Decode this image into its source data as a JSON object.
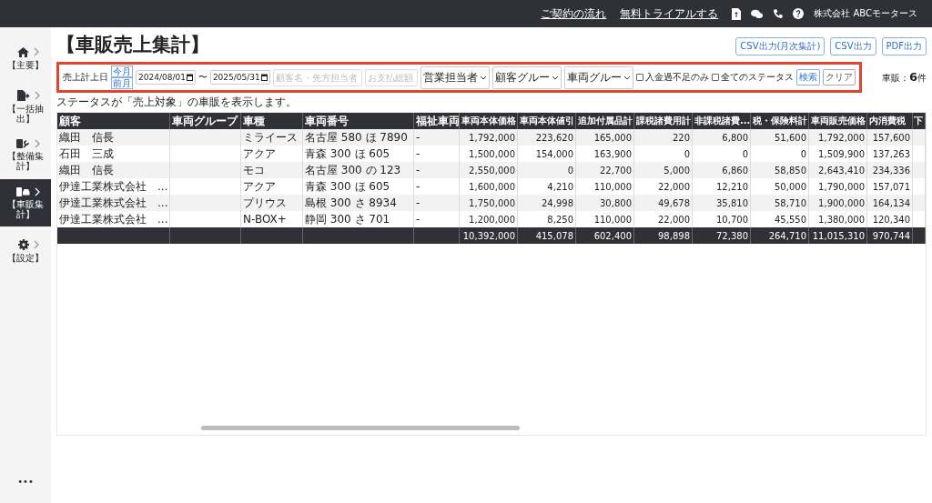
{
  "top_bar": {
    "links": [
      "ご契約の流れ",
      "無料トライアルする"
    ],
    "company": "株式会社 ABCモータース"
  },
  "sidebar": {
    "items": [
      {
        "label": "【主要】",
        "selected": false
      },
      {
        "label": "【一括抽出】",
        "selected": false
      },
      {
        "label": "【整備集計】",
        "selected": false
      },
      {
        "label": "【車販集計】",
        "selected": true
      },
      {
        "label": "【設定】",
        "selected": false
      }
    ],
    "more": "•••"
  },
  "page": {
    "title": "【車販売上集計】",
    "buttons": [
      "CSV出力(月次集計)",
      "CSV出力",
      "PDF出力"
    ]
  },
  "filters": {
    "date_label": "売上計上日",
    "quick": [
      "今月",
      "前月"
    ],
    "date_from": "2024/08/01",
    "separator": "〜",
    "date_to": "2025/05/31",
    "text_fields": [
      {
        "placeholder": "顧客名・先方担当者"
      },
      {
        "placeholder": "お支払総額"
      }
    ],
    "selects": [
      "営業担当者",
      "顧客グルー",
      "車両グルー"
    ],
    "checkboxes": [
      {
        "label": "入金過不足のみ",
        "checked": false
      },
      {
        "label": "全てのステータス",
        "checked": false
      }
    ],
    "search": "検索",
    "clear": "クリア",
    "count_label": "車販：",
    "count": "6",
    "count_unit": "件"
  },
  "note": "ステータスが「売上対象」の車販を表示します。",
  "table": {
    "columns": [
      "顧客",
      "車両グループ",
      "車種",
      "車両番号",
      "福祉車両",
      "車両本体価格",
      "車両本体値引",
      "追加付属品計",
      "課税諸費用計",
      "非課税諸費...",
      "税・保険料計",
      "車両販売価格",
      "内消費税",
      "下"
    ],
    "rows": [
      [
        "織田　信長",
        "",
        "ミライース",
        "名古屋 580 ほ 7890",
        "-",
        "1,792,000",
        "223,620",
        "165,000",
        "220",
        "6,800",
        "51,600",
        "1,792,000",
        "157,600"
      ],
      [
        "石田　三成",
        "",
        "アクア",
        "青森 300 ほ 605",
        "-",
        "1,500,000",
        "154,000",
        "163,900",
        "0",
        "0",
        "0",
        "1,509,900",
        "137,263"
      ],
      [
        "織田　信長",
        "",
        "モコ",
        "名古屋 300 の 123",
        "-",
        "2,550,000",
        "0",
        "22,700",
        "5,000",
        "6,860",
        "58,850",
        "2,643,410",
        "234,336"
      ],
      [
        "伊達工業株式会社　...",
        "",
        "アクア",
        "青森 300 ほ 605",
        "-",
        "1,600,000",
        "4,210",
        "110,000",
        "22,000",
        "12,210",
        "50,000",
        "1,790,000",
        "157,071"
      ],
      [
        "伊達工業株式会社　...",
        "",
        "プリウス",
        "島根 300 さ 8934",
        "-",
        "1,750,000",
        "24,998",
        "30,800",
        "49,678",
        "35,810",
        "58,710",
        "1,900,000",
        "164,134"
      ],
      [
        "伊達工業株式会社　...",
        "",
        "N-BOX+",
        "静岡 300 さ 701",
        "-",
        "1,200,000",
        "8,250",
        "110,000",
        "22,000",
        "10,700",
        "45,550",
        "1,380,000",
        "120,340"
      ]
    ],
    "totals": [
      "10,392,000",
      "415,078",
      "602,400",
      "98,898",
      "72,380",
      "264,710",
      "11,015,310",
      "970,744"
    ]
  }
}
